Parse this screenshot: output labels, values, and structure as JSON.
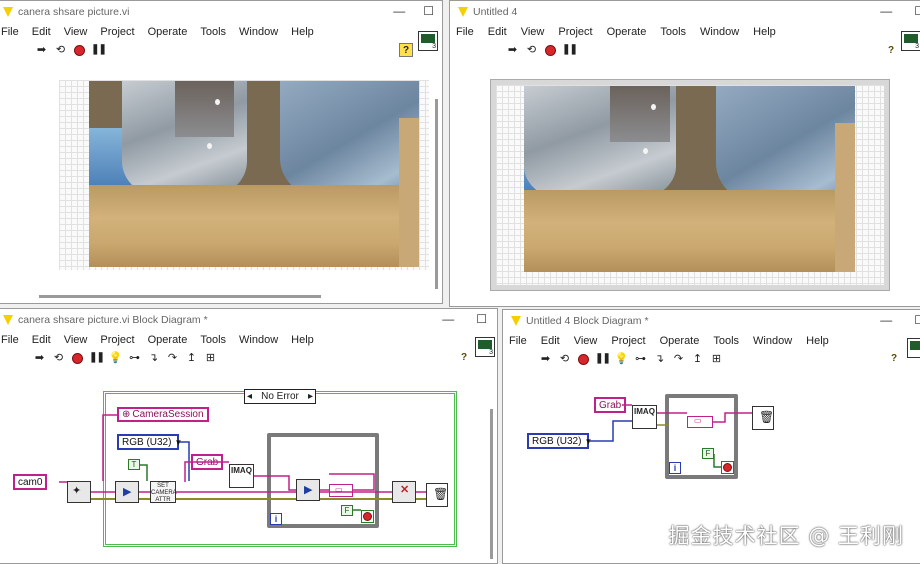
{
  "front_panel_1": {
    "title": "canera shsare picture.vi",
    "menu": [
      "File",
      "Edit",
      "View",
      "Project",
      "Operate",
      "Tools",
      "Window",
      "Help"
    ],
    "help_glyph": "?"
  },
  "front_panel_2": {
    "title": "Untitled 4",
    "menu": [
      "File",
      "Edit",
      "View",
      "Project",
      "Operate",
      "Tools",
      "Window",
      "Help"
    ],
    "help_glyph": "?"
  },
  "block_diagram_1": {
    "title": "canera shsare picture.vi Block Diagram *",
    "menu": [
      "File",
      "Edit",
      "View",
      "Project",
      "Operate",
      "Tools",
      "Window",
      "Help"
    ],
    "help_glyph": "?",
    "case_selector": "No Error",
    "camera_session_label": "CameraSession",
    "rgb_constant": "RGB (U32)",
    "grab_constant": "Grab",
    "cam_constant": "cam0",
    "imaq_label": "IMAQ",
    "config_label": "SET CAMERA ATTR",
    "true_const": "T",
    "false_const": "F",
    "iter_label": "i"
  },
  "block_diagram_2": {
    "title": "Untitled 4 Block Diagram *",
    "menu": [
      "File",
      "Edit",
      "View",
      "Project",
      "Operate",
      "Tools",
      "Window",
      "Help"
    ],
    "help_glyph": "?",
    "grab_constant": "Grab",
    "rgb_constant": "RGB (U32)",
    "imaq_label": "IMAQ",
    "false_const": "F",
    "iter_label": "i"
  },
  "watermark": "掘金技术社区 @ 王利刚",
  "colors": {
    "pink_wire": "#c0208a",
    "blue_wire": "#2a3bb4",
    "olive_wire": "#8c8a2a",
    "case_green": "#4dbb4d",
    "loop_gray": "#7a7a7a"
  }
}
